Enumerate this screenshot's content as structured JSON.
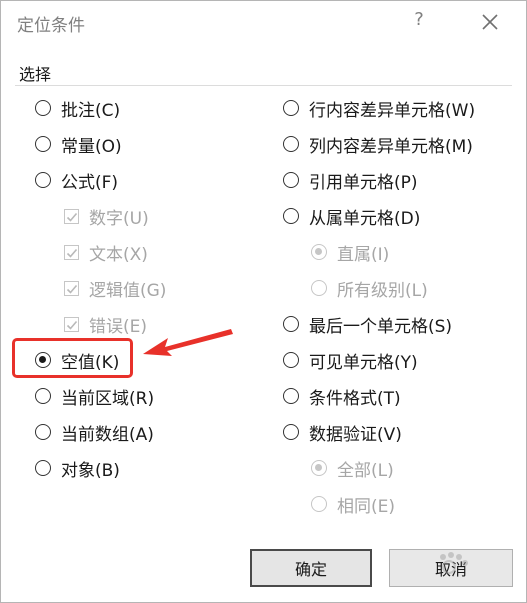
{
  "dialog": {
    "title": "定位条件",
    "help_label": "?",
    "group_label": "选择"
  },
  "left_options": [
    {
      "label": "批注(C)",
      "state": "unchecked"
    },
    {
      "label": "常量(O)",
      "state": "unchecked"
    },
    {
      "label": "公式(F)",
      "state": "unchecked"
    },
    {
      "label": "数字(U)",
      "state": "checked-disabled"
    },
    {
      "label": "文本(X)",
      "state": "checked-disabled"
    },
    {
      "label": "逻辑值(G)",
      "state": "checked-disabled"
    },
    {
      "label": "错误(E)",
      "state": "checked-disabled"
    },
    {
      "label": "空值(K)",
      "state": "selected"
    },
    {
      "label": "当前区域(R)",
      "state": "unchecked"
    },
    {
      "label": "当前数组(A)",
      "state": "unchecked"
    },
    {
      "label": "对象(B)",
      "state": "unchecked"
    }
  ],
  "right_options": [
    {
      "label": "行内容差异单元格(W)",
      "state": "unchecked"
    },
    {
      "label": "列内容差异单元格(M)",
      "state": "unchecked"
    },
    {
      "label": "引用单元格(P)",
      "state": "unchecked"
    },
    {
      "label": "从属单元格(D)",
      "state": "unchecked"
    },
    {
      "label": "直属(I)",
      "state": "selected-disabled"
    },
    {
      "label": "所有级别(L)",
      "state": "disabled"
    },
    {
      "label": "最后一个单元格(S)",
      "state": "unchecked"
    },
    {
      "label": "可见单元格(Y)",
      "state": "unchecked"
    },
    {
      "label": "条件格式(T)",
      "state": "unchecked"
    },
    {
      "label": "数据验证(V)",
      "state": "unchecked"
    },
    {
      "label": "全部(L)",
      "state": "selected-disabled"
    },
    {
      "label": "相同(E)",
      "state": "disabled"
    }
  ],
  "buttons": {
    "ok": "确定",
    "cancel": "取消"
  },
  "annotation": {
    "highlight_color": "#e8312a"
  }
}
